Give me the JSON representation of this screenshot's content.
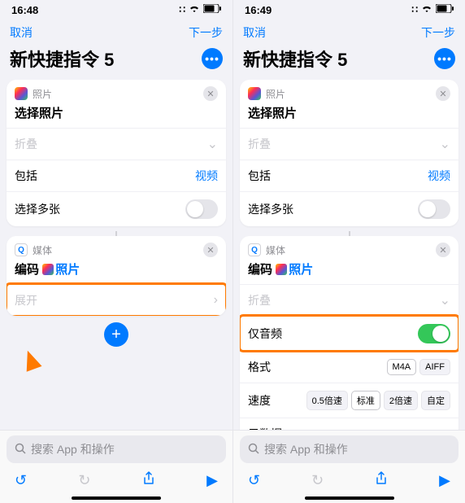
{
  "left": {
    "status": {
      "time": "16:48"
    },
    "nav": {
      "cancel": "取消",
      "next": "下一步"
    },
    "title": "新快捷指令 5",
    "card_photos": {
      "app": "照片",
      "title": "选择照片",
      "collapse": "折叠",
      "include_label": "包括",
      "include_value": "视频",
      "multi": "选择多张"
    },
    "card_media": {
      "app": "媒体",
      "title_prefix": "编码",
      "title_token": "照片",
      "expand": "展开"
    },
    "search_placeholder": "搜索 App 和操作"
  },
  "right": {
    "status": {
      "time": "16:49"
    },
    "nav": {
      "cancel": "取消",
      "next": "下一步"
    },
    "title": "新快捷指令 5",
    "card_photos": {
      "app": "照片",
      "title": "选择照片",
      "collapse": "折叠",
      "include_label": "包括",
      "include_value": "视频",
      "multi": "选择多张"
    },
    "card_media": {
      "app": "媒体",
      "title_prefix": "编码",
      "title_token": "照片",
      "collapse": "折叠",
      "audio_only": "仅音频",
      "format_label": "格式",
      "format_options": [
        "M4A",
        "AIFF"
      ],
      "speed_label": "速度",
      "speed_options": [
        "0.5倍速",
        "标准",
        "2倍速",
        "自定"
      ],
      "metadata": "元数据"
    },
    "search_placeholder": "搜索 App 和操作"
  }
}
